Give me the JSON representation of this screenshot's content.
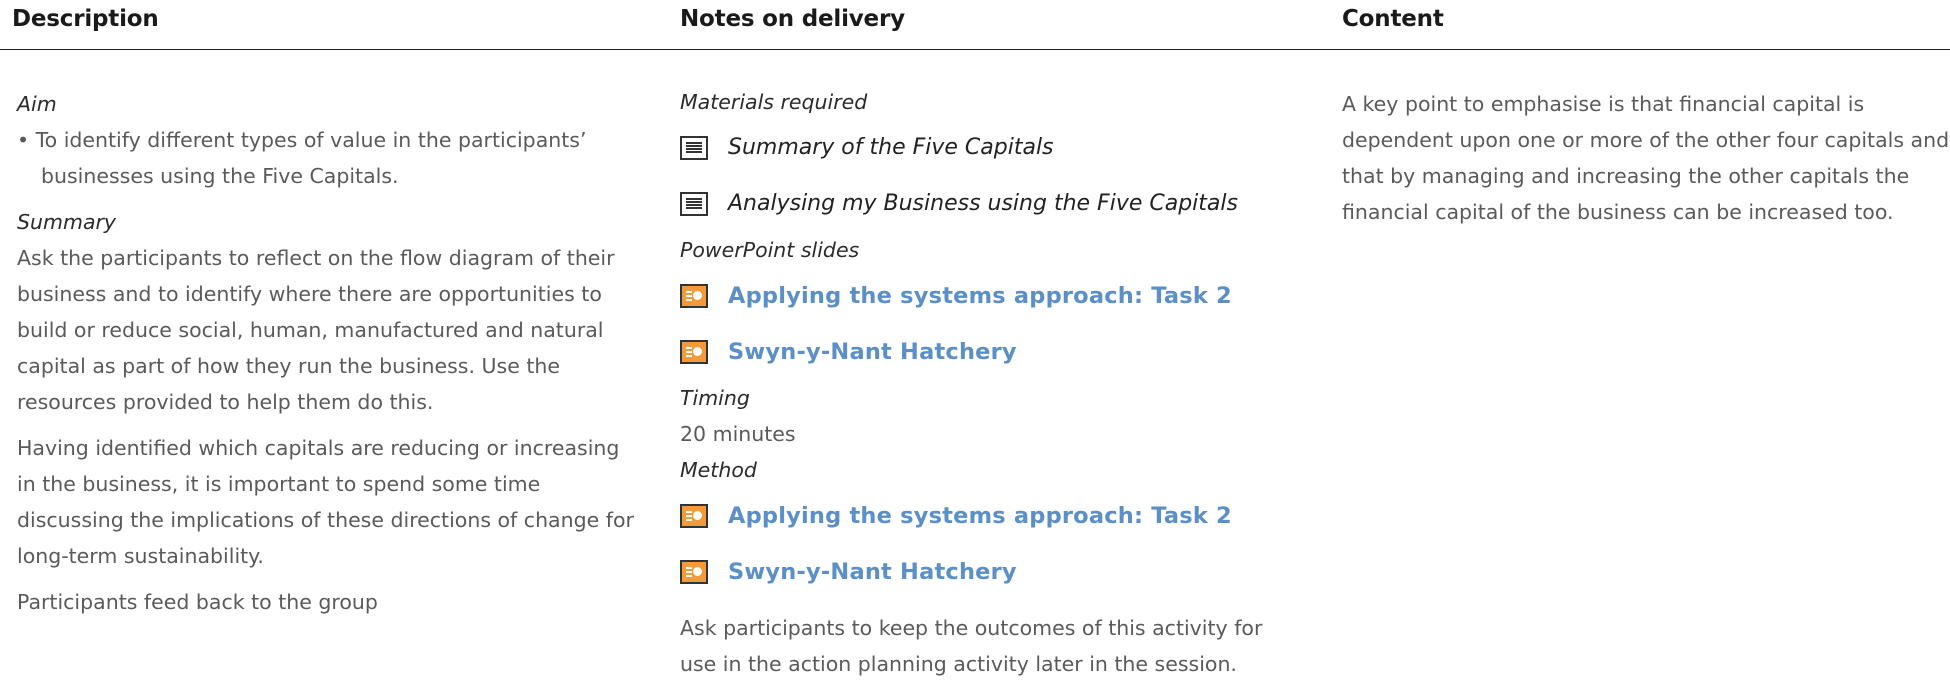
{
  "headers": {
    "description": "Description",
    "notes": "Notes on delivery",
    "content": "Content"
  },
  "description": {
    "aim_heading": "Aim",
    "aim_bullet": "• To identify different types of value in the participants’ businesses using the Five Capitals.",
    "summary_heading": "Summary",
    "summary_p1": "Ask the participants to reflect on the flow diagram of their business and to identify where there are opportunities to build or reduce social, human, manufactured and natural capital as part of how they run the business. Use the resources provided to help them do this.",
    "summary_p2": "Having identified which capitals are reducing or increasing in the business, it is important to spend some time discussing the implications of these directions of change for long-term sustainability.",
    "summary_p3": "Participants feed back to the group"
  },
  "notes": {
    "materials_heading": "Materials required",
    "materials": [
      {
        "label": "Summary of the Five Capitals",
        "icon": "document-icon"
      },
      {
        "label": "Analysing my Business using the Five Capitals",
        "icon": "document-icon"
      }
    ],
    "slides_heading": "PowerPoint slides",
    "slides": [
      {
        "label": "Applying the systems approach: Task 2",
        "icon": "powerpoint-icon"
      },
      {
        "label": "Swyn-y-Nant Hatchery",
        "icon": "powerpoint-icon"
      }
    ],
    "timing_heading": "Timing",
    "timing_value": "20 minutes",
    "method_heading": "Method",
    "method_slides": [
      {
        "label": "Applying the systems approach: Task 2",
        "icon": "powerpoint-icon"
      },
      {
        "label": "Swyn-y-Nant Hatchery",
        "icon": "powerpoint-icon"
      }
    ],
    "closing": "Ask participants to keep the outcomes of this activity for use in the action planning activity later in the session."
  },
  "content": {
    "text": "A key point to emphasise is that financial capital is dependent upon one or more of the other four capitals and that by managing and increasing the other capitals the financial capital of the business can be increased too."
  },
  "colors": {
    "link": "#5b8fc6",
    "powerpoint_icon": "#f39a3b",
    "rule": "#222222"
  }
}
